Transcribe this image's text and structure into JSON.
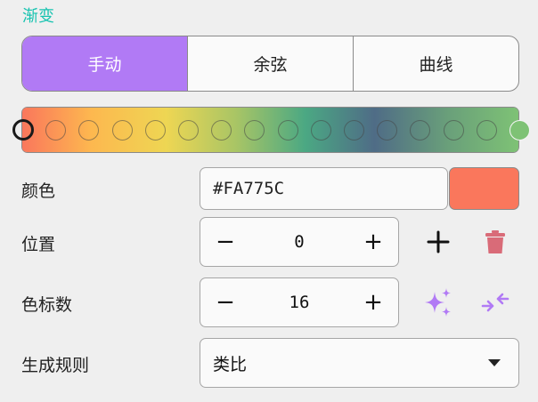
{
  "section_title": "渐变",
  "modes": [
    {
      "label": "手动",
      "active": true
    },
    {
      "label": "余弦",
      "active": false
    },
    {
      "label": "曲线",
      "active": false
    }
  ],
  "gradient": {
    "stops_count": 16,
    "selected_index": 0,
    "colors": [
      "#FA775C",
      "#FDB84F",
      "#EED653",
      "#A9C565",
      "#4BA883",
      "#4F6C86",
      "#6AA07A",
      "#7EC275"
    ]
  },
  "color_row": {
    "label": "颜色",
    "hex_value": "#FA775C",
    "swatch_color": "#FA775C"
  },
  "position_row": {
    "label": "位置",
    "value": "0",
    "minus": "−",
    "plus": "+",
    "add_icon": "plus-icon",
    "delete_icon": "trash-icon"
  },
  "stop_count_row": {
    "label": "色标数",
    "value": "16",
    "minus": "−",
    "plus": "+",
    "sparkle_icon": "sparkle-icon",
    "compress_icon": "compress-arrows-icon"
  },
  "rule_row": {
    "label": "生成规则",
    "selected": "类比"
  },
  "accent_color": "#B17AF5",
  "title_color": "#17C3B0",
  "delete_color": "#D96B78"
}
